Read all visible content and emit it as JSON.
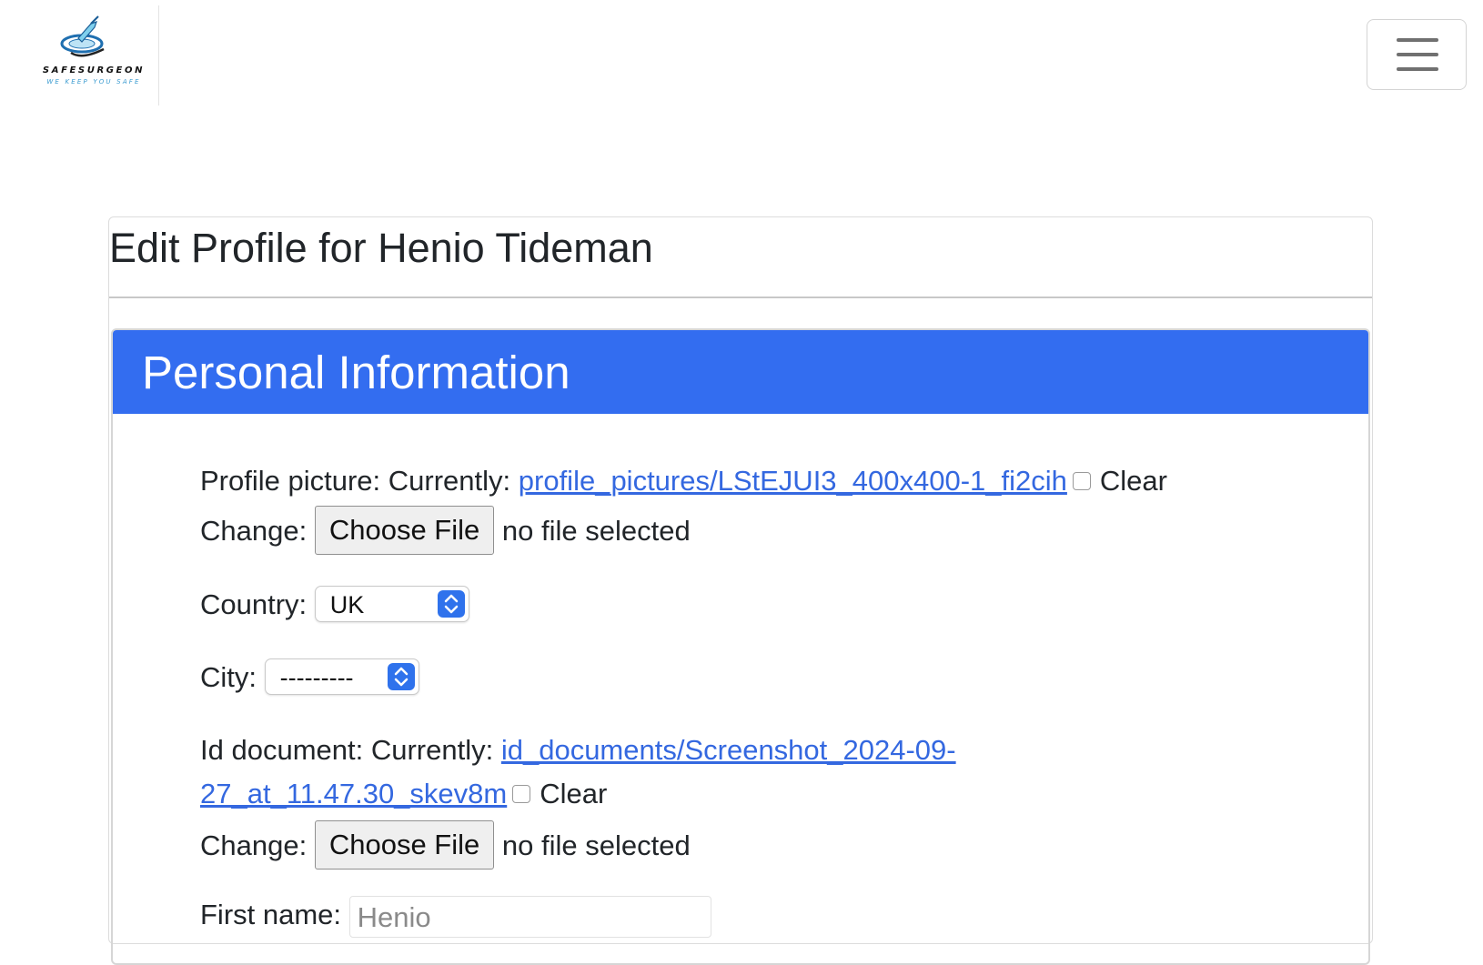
{
  "brand": {
    "name": "SAFESURGEON",
    "tagline": "WE KEEP YOU SAFE"
  },
  "page": {
    "title": "Edit Profile for Henio Tideman"
  },
  "section": {
    "title": "Personal Information"
  },
  "form": {
    "profile_picture": {
      "label": "Profile picture:",
      "currently_label": "Currently:",
      "current_file": "profile_pictures/LStEJUI3_400x400-1_fi2cih",
      "clear_label": "Clear",
      "change_label": "Change:",
      "button_label": "Choose File",
      "status": "no file selected"
    },
    "country": {
      "label": "Country:",
      "value": "UK"
    },
    "city": {
      "label": "City:",
      "value": "---------"
    },
    "id_document": {
      "label": "Id document:",
      "currently_label": "Currently:",
      "current_file_line1": "id_documents/Screenshot_2024-09-",
      "current_file_line2": "27_at_11.47.30_skev8m",
      "clear_label": "Clear",
      "change_label": "Change:",
      "button_label": "Choose File",
      "status": "no file selected"
    },
    "first_name": {
      "label": "First name:",
      "value": "Henio"
    }
  },
  "colors": {
    "header_bg": "#336df0",
    "link": "#3468e0",
    "select_accent": "#2f72ec"
  },
  "icons": {
    "menu": "hamburger-icon",
    "select": "chevron-up-down-icon"
  }
}
